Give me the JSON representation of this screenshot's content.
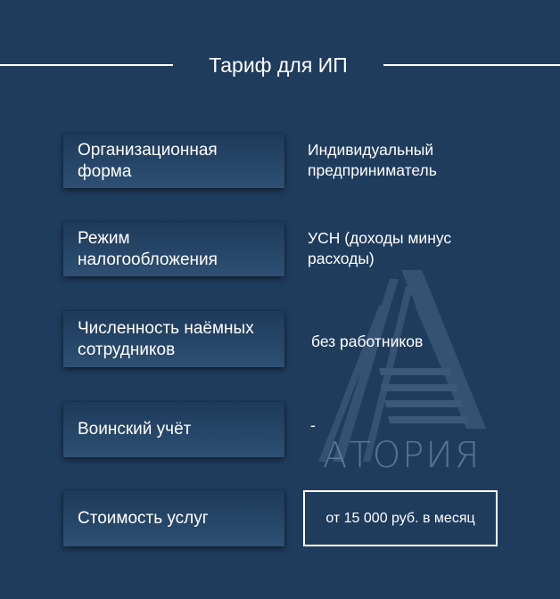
{
  "header": {
    "title": "Тариф для ИП"
  },
  "rows": [
    {
      "label": "Организационная\nформа",
      "value": "Индивидуальный\nпредприниматель"
    },
    {
      "label": "Режим\nналогообложения",
      "value": "УСН (доходы минус\nрасходы)"
    },
    {
      "label": "Численность наёмных\nсотрудников",
      "value": "без работников"
    },
    {
      "label": "Воинский учёт",
      "value": "-"
    },
    {
      "label": "Стоимость услуг",
      "value": "от 15 000 руб. в месяц"
    }
  ],
  "logo": {
    "text": "АТОРИЯ"
  },
  "colors": {
    "background": "#1f3c5d",
    "box_top": "#1e3a5a",
    "box_bottom": "#2e5072",
    "text": "#ffffff"
  }
}
